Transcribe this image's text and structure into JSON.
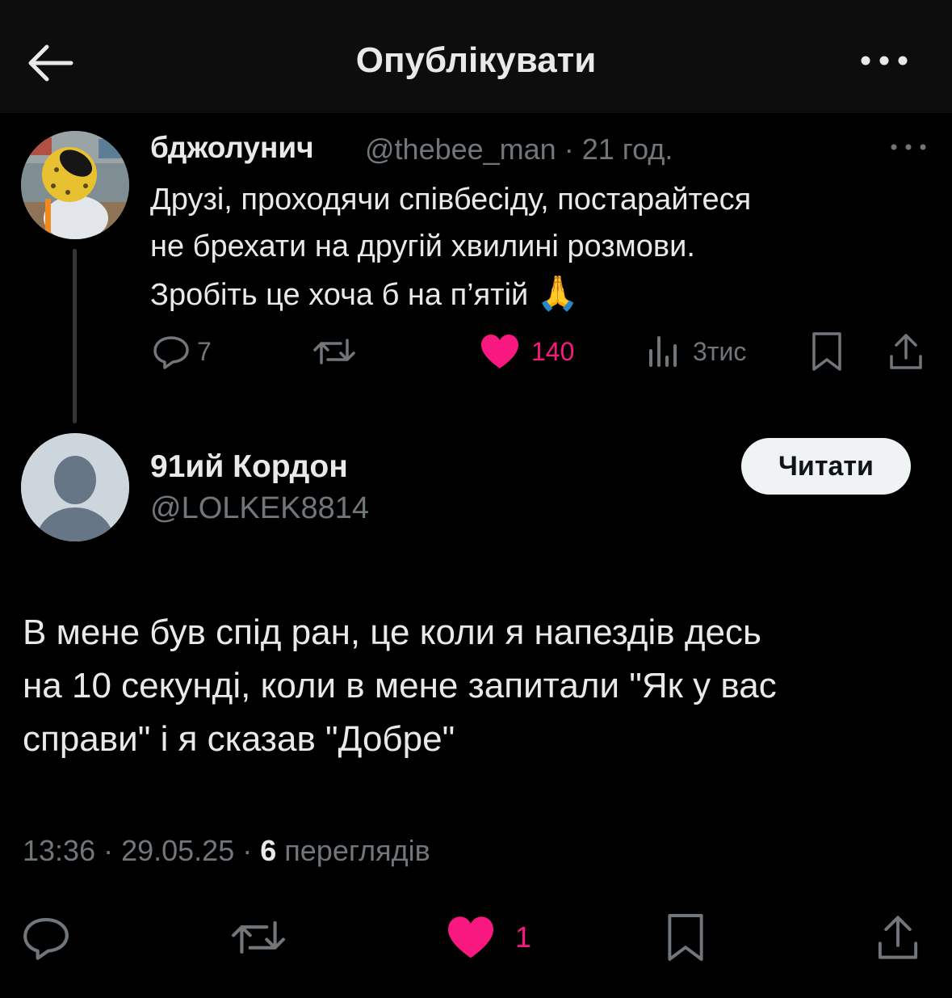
{
  "header": {
    "title": "Опублікувати"
  },
  "parent": {
    "name": "бджолунич",
    "handle": "@thebee_man",
    "time": "21 год.",
    "lines": [
      "Друзі, проходячи співбесіду, постарайтеся",
      "не брехати на другій хвилині розмови.",
      "Зробіть це хоча б на п’ятій"
    ],
    "emoji": "🙏",
    "stats": {
      "replies": "7",
      "likes": "140",
      "views": "3тис"
    }
  },
  "reply": {
    "name": "91ий Кордон",
    "handle": "@LOLKEK8814",
    "follow_label": "Читати",
    "lines": [
      "В мене був спід ран, це коли я напездів десь",
      "на 10 секунді, коли в мене запитали \"Як у вас",
      "справи\" і я сказав \"Добре\""
    ],
    "time": "13:36",
    "date": "29.05.25",
    "views_count": "6",
    "views_label": "переглядів",
    "likes": "1"
  },
  "colors": {
    "accent_like": "#f91880",
    "muted": "#71767b",
    "text": "#e7e9ea",
    "background": "#000000"
  },
  "icons": [
    "back-arrow-icon",
    "more-icon",
    "reply-icon",
    "retweet-icon",
    "heart-icon",
    "views-icon",
    "bookmark-icon",
    "share-icon"
  ]
}
